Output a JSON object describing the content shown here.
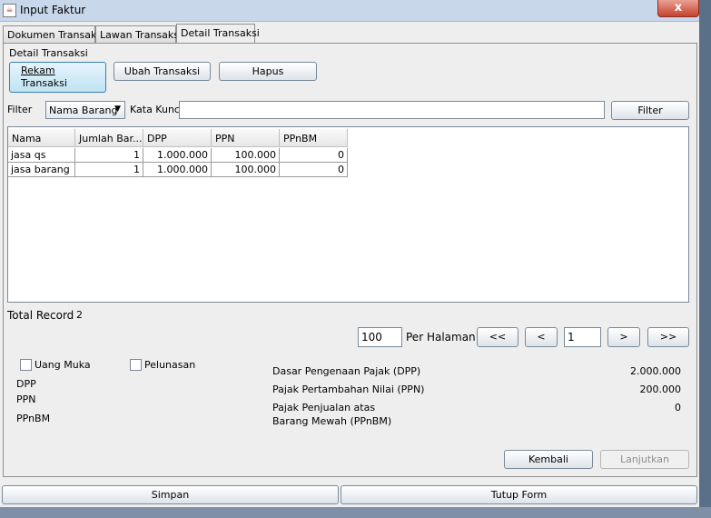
{
  "window": {
    "title": "Input Faktur",
    "close_glyph": "x"
  },
  "tabs": [
    {
      "label": "Dokumen Transaksi"
    },
    {
      "label": "Lawan Transaksi"
    },
    {
      "label": "Detail Transaksi"
    }
  ],
  "group_title": "Detail Transaksi",
  "actions": {
    "rekam_line1": "Rekam",
    "rekam_line2": "Transaksi",
    "ubah": "Ubah Transaksi",
    "hapus": "Hapus"
  },
  "filter": {
    "label": "Filter",
    "selected": "Nama Barang",
    "keyword_label": "Kata Kunci",
    "keyword_value": "",
    "button": "Filter"
  },
  "table": {
    "columns": [
      "Nama",
      "Jumlah Bar...",
      "DPP",
      "PPN",
      "PPnBM"
    ],
    "rows": [
      [
        "jasa qs",
        "1",
        "1.000.000",
        "100.000",
        "0"
      ],
      [
        "jasa barang",
        "1",
        "1.000.000",
        "100.000",
        "0"
      ]
    ]
  },
  "total": {
    "label": "Total Record",
    "value": "2"
  },
  "pagination": {
    "per_page": "100",
    "per_page_label": "Per Halaman",
    "first": "<<",
    "prev": "<",
    "page": "1",
    "next": ">",
    "last": ">>"
  },
  "options": {
    "uang_muka": "Uang Muka",
    "pelunasan": "Pelunasan"
  },
  "left_labels": {
    "dpp": "DPP",
    "ppn": "PPN",
    "ppnbm": "PPnBM"
  },
  "summary": {
    "dpp_label": "Dasar Pengenaan Pajak (DPP)",
    "dpp_value": "2.000.000",
    "ppn_label": "Pajak Pertambahan Nilai (PPN)",
    "ppn_value": "200.000",
    "ppnbm_label_1": "Pajak Penjualan atas",
    "ppnbm_label_2": "Barang Mewah (PPnBM)",
    "ppnbm_value": "0"
  },
  "footer": {
    "kembali": "Kembali",
    "lanjutkan": "Lanjutkan",
    "simpan": "Simpan",
    "tutup": "Tutup Form"
  },
  "colors": {
    "selected_button": "#bfe3f3",
    "titlebar": "#c9d7ea",
    "close_button": "#c7412d"
  }
}
